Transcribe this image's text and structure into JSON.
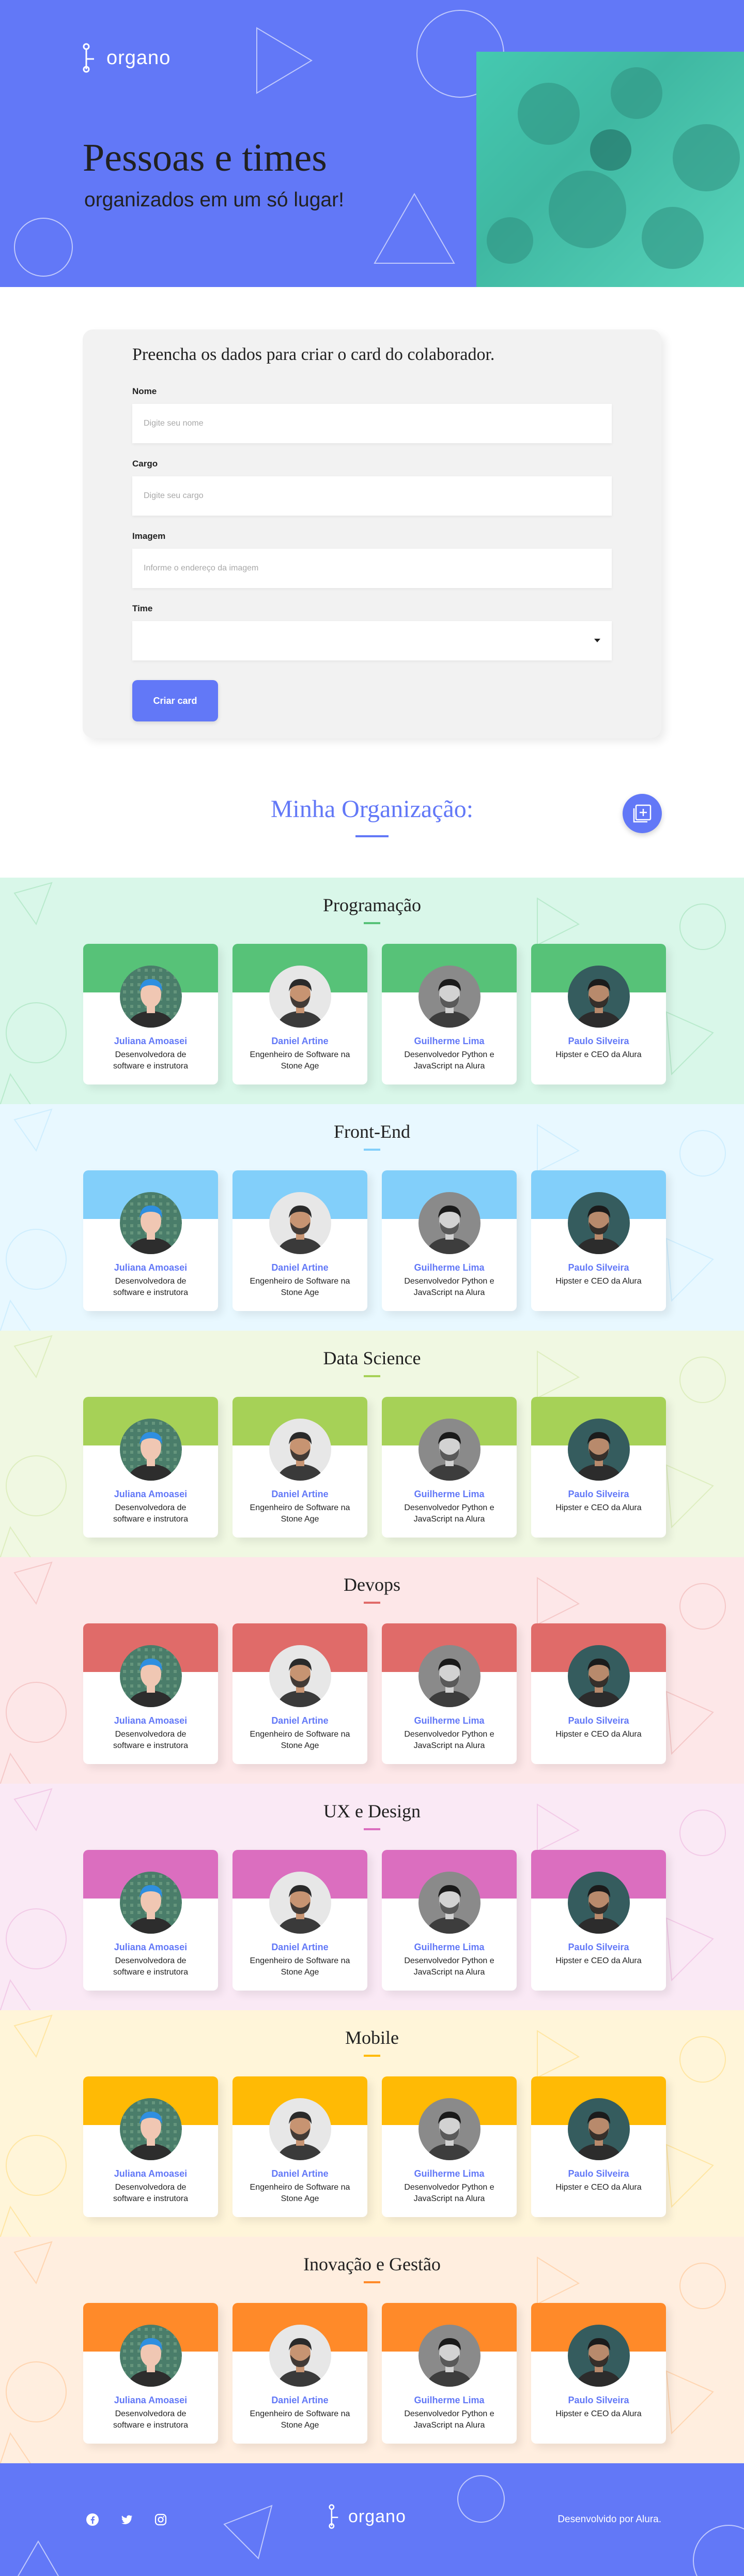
{
  "brand": {
    "logo_text": "organo"
  },
  "hero": {
    "title": "Pessoas e times",
    "subtitle": "organizados em um só lugar!"
  },
  "form": {
    "title": "Preencha os dados para criar o card do colaborador.",
    "fields": [
      {
        "label": "Nome",
        "placeholder": "Digite seu nome",
        "value": ""
      },
      {
        "label": "Cargo",
        "placeholder": "Digite seu cargo",
        "value": ""
      },
      {
        "label": "Imagem",
        "placeholder": "Informe o endereço da imagem",
        "value": ""
      }
    ],
    "select": {
      "label": "Time",
      "value": ""
    },
    "submit_label": "Criar card"
  },
  "organization": {
    "title": "Minha Organização:"
  },
  "members": [
    {
      "name": "Juliana Amoasei",
      "role": "Desenvolvedora de software e instrutora"
    },
    {
      "name": "Daniel Artine",
      "role": "Engenheiro de Software na Stone Age"
    },
    {
      "name": "Guilherme Lima",
      "role": "Desenvolvedor Python e JavaScript na Alura"
    },
    {
      "name": "Paulo Silveira",
      "role": "Hipster e CEO da Alura"
    }
  ],
  "teams": [
    {
      "name": "Programação",
      "primary": "#57c278",
      "secondary": "#d9f7e9"
    },
    {
      "name": "Front-End",
      "primary": "#82cffa",
      "secondary": "#e8f8ff"
    },
    {
      "name": "Data Science",
      "primary": "#a6d157",
      "secondary": "#f0f8e2"
    },
    {
      "name": "Devops",
      "primary": "#e06b69",
      "secondary": "#fde7e8"
    },
    {
      "name": "UX e Design",
      "primary": "#db6ebf",
      "secondary": "#fae9f5"
    },
    {
      "name": "Mobile",
      "primary": "#ffba05",
      "secondary": "#fff5d9"
    },
    {
      "name": "Inovação e Gestão",
      "primary": "#ff8a29",
      "secondary": "#ffeedf"
    }
  ],
  "footer": {
    "social_icons": [
      "facebook-icon",
      "twitter-icon",
      "instagram-icon"
    ],
    "credit": "Desenvolvido por Alura."
  },
  "colors": {
    "accent": "#6278f7",
    "text": "#212121"
  }
}
